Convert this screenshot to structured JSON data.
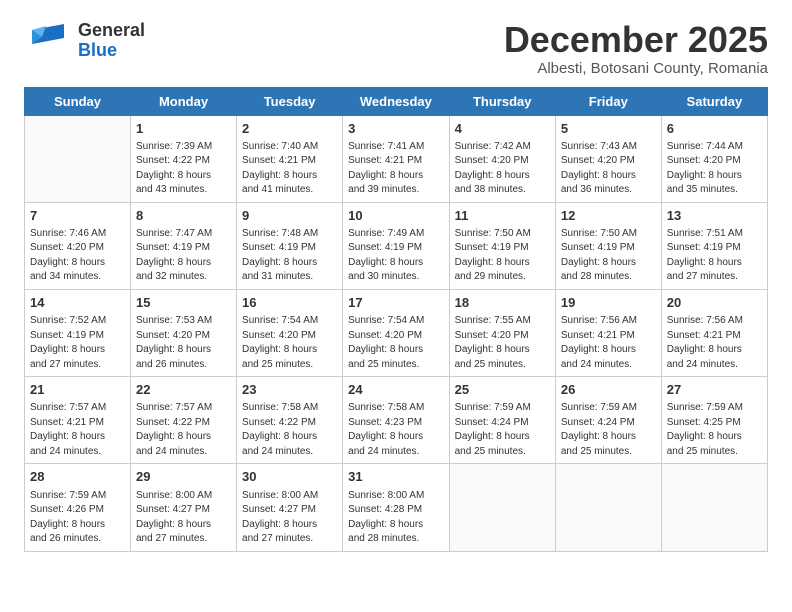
{
  "header": {
    "logo_general": "General",
    "logo_blue": "Blue",
    "month_title": "December 2025",
    "subtitle": "Albesti, Botosani County, Romania"
  },
  "days_of_week": [
    "Sunday",
    "Monday",
    "Tuesday",
    "Wednesday",
    "Thursday",
    "Friday",
    "Saturday"
  ],
  "weeks": [
    [
      {
        "day": "",
        "info": ""
      },
      {
        "day": "1",
        "info": "Sunrise: 7:39 AM\nSunset: 4:22 PM\nDaylight: 8 hours\nand 43 minutes."
      },
      {
        "day": "2",
        "info": "Sunrise: 7:40 AM\nSunset: 4:21 PM\nDaylight: 8 hours\nand 41 minutes."
      },
      {
        "day": "3",
        "info": "Sunrise: 7:41 AM\nSunset: 4:21 PM\nDaylight: 8 hours\nand 39 minutes."
      },
      {
        "day": "4",
        "info": "Sunrise: 7:42 AM\nSunset: 4:20 PM\nDaylight: 8 hours\nand 38 minutes."
      },
      {
        "day": "5",
        "info": "Sunrise: 7:43 AM\nSunset: 4:20 PM\nDaylight: 8 hours\nand 36 minutes."
      },
      {
        "day": "6",
        "info": "Sunrise: 7:44 AM\nSunset: 4:20 PM\nDaylight: 8 hours\nand 35 minutes."
      }
    ],
    [
      {
        "day": "7",
        "info": "Sunrise: 7:46 AM\nSunset: 4:20 PM\nDaylight: 8 hours\nand 34 minutes."
      },
      {
        "day": "8",
        "info": "Sunrise: 7:47 AM\nSunset: 4:19 PM\nDaylight: 8 hours\nand 32 minutes."
      },
      {
        "day": "9",
        "info": "Sunrise: 7:48 AM\nSunset: 4:19 PM\nDaylight: 8 hours\nand 31 minutes."
      },
      {
        "day": "10",
        "info": "Sunrise: 7:49 AM\nSunset: 4:19 PM\nDaylight: 8 hours\nand 30 minutes."
      },
      {
        "day": "11",
        "info": "Sunrise: 7:50 AM\nSunset: 4:19 PM\nDaylight: 8 hours\nand 29 minutes."
      },
      {
        "day": "12",
        "info": "Sunrise: 7:50 AM\nSunset: 4:19 PM\nDaylight: 8 hours\nand 28 minutes."
      },
      {
        "day": "13",
        "info": "Sunrise: 7:51 AM\nSunset: 4:19 PM\nDaylight: 8 hours\nand 27 minutes."
      }
    ],
    [
      {
        "day": "14",
        "info": "Sunrise: 7:52 AM\nSunset: 4:19 PM\nDaylight: 8 hours\nand 27 minutes."
      },
      {
        "day": "15",
        "info": "Sunrise: 7:53 AM\nSunset: 4:20 PM\nDaylight: 8 hours\nand 26 minutes."
      },
      {
        "day": "16",
        "info": "Sunrise: 7:54 AM\nSunset: 4:20 PM\nDaylight: 8 hours\nand 25 minutes."
      },
      {
        "day": "17",
        "info": "Sunrise: 7:54 AM\nSunset: 4:20 PM\nDaylight: 8 hours\nand 25 minutes."
      },
      {
        "day": "18",
        "info": "Sunrise: 7:55 AM\nSunset: 4:20 PM\nDaylight: 8 hours\nand 25 minutes."
      },
      {
        "day": "19",
        "info": "Sunrise: 7:56 AM\nSunset: 4:21 PM\nDaylight: 8 hours\nand 24 minutes."
      },
      {
        "day": "20",
        "info": "Sunrise: 7:56 AM\nSunset: 4:21 PM\nDaylight: 8 hours\nand 24 minutes."
      }
    ],
    [
      {
        "day": "21",
        "info": "Sunrise: 7:57 AM\nSunset: 4:21 PM\nDaylight: 8 hours\nand 24 minutes."
      },
      {
        "day": "22",
        "info": "Sunrise: 7:57 AM\nSunset: 4:22 PM\nDaylight: 8 hours\nand 24 minutes."
      },
      {
        "day": "23",
        "info": "Sunrise: 7:58 AM\nSunset: 4:22 PM\nDaylight: 8 hours\nand 24 minutes."
      },
      {
        "day": "24",
        "info": "Sunrise: 7:58 AM\nSunset: 4:23 PM\nDaylight: 8 hours\nand 24 minutes."
      },
      {
        "day": "25",
        "info": "Sunrise: 7:59 AM\nSunset: 4:24 PM\nDaylight: 8 hours\nand 25 minutes."
      },
      {
        "day": "26",
        "info": "Sunrise: 7:59 AM\nSunset: 4:24 PM\nDaylight: 8 hours\nand 25 minutes."
      },
      {
        "day": "27",
        "info": "Sunrise: 7:59 AM\nSunset: 4:25 PM\nDaylight: 8 hours\nand 25 minutes."
      }
    ],
    [
      {
        "day": "28",
        "info": "Sunrise: 7:59 AM\nSunset: 4:26 PM\nDaylight: 8 hours\nand 26 minutes."
      },
      {
        "day": "29",
        "info": "Sunrise: 8:00 AM\nSunset: 4:27 PM\nDaylight: 8 hours\nand 27 minutes."
      },
      {
        "day": "30",
        "info": "Sunrise: 8:00 AM\nSunset: 4:27 PM\nDaylight: 8 hours\nand 27 minutes."
      },
      {
        "day": "31",
        "info": "Sunrise: 8:00 AM\nSunset: 4:28 PM\nDaylight: 8 hours\nand 28 minutes."
      },
      {
        "day": "",
        "info": ""
      },
      {
        "day": "",
        "info": ""
      },
      {
        "day": "",
        "info": ""
      }
    ]
  ]
}
